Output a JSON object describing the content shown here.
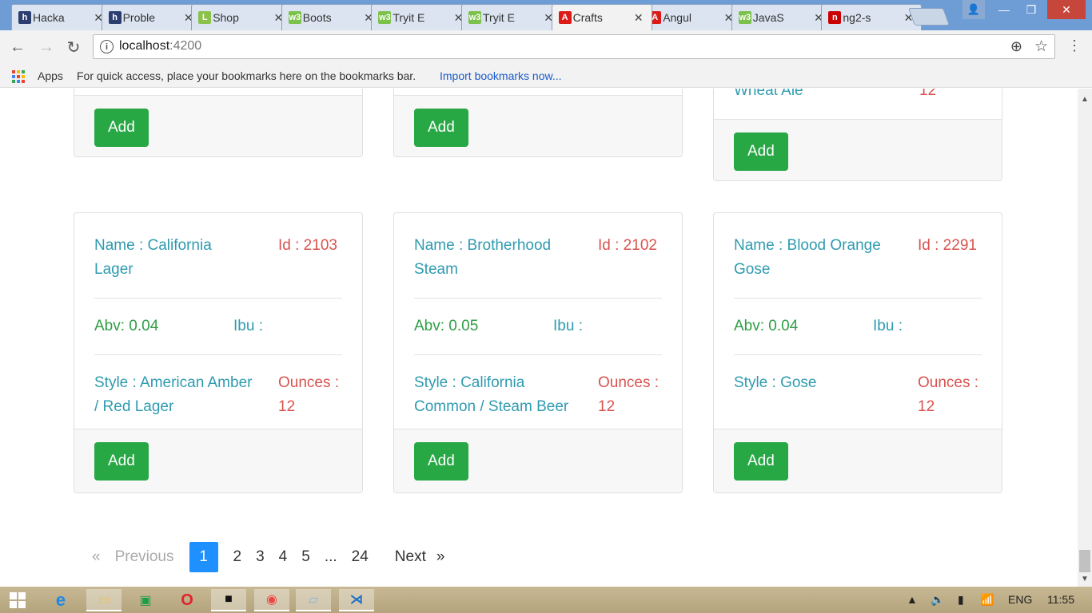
{
  "browser": {
    "tabs": [
      {
        "title": "Hacka",
        "icon": "hackerrank-icon",
        "color": "#2c3e70",
        "glyph": "h"
      },
      {
        "title": "Proble",
        "icon": "hackerrank-icon",
        "color": "#2c3e70",
        "glyph": "h"
      },
      {
        "title": "Shop",
        "icon": "leaf-icon",
        "color": "#8bc34a",
        "glyph": "L"
      },
      {
        "title": "Boots",
        "icon": "w3schools-icon",
        "color": "#7cc24a",
        "glyph": "w3"
      },
      {
        "title": "Tryit E",
        "icon": "w3schools-icon",
        "color": "#7cc24a",
        "glyph": "w3"
      },
      {
        "title": "Tryit E",
        "icon": "w3schools-icon",
        "color": "#7cc24a",
        "glyph": "w3"
      },
      {
        "title": "Crafts",
        "icon": "angular-icon",
        "color": "#dd1b16",
        "glyph": "A",
        "active": true
      },
      {
        "title": "Angul",
        "icon": "angular-icon",
        "color": "#dd1b16",
        "glyph": "A"
      },
      {
        "title": "JavaS",
        "icon": "w3schools-icon",
        "color": "#7cc24a",
        "glyph": "w3"
      },
      {
        "title": "ng2-s",
        "icon": "npm-icon",
        "color": "#cb0000",
        "glyph": "n"
      }
    ],
    "url_host": "localhost",
    "url_port": ":4200",
    "bookmarks_apps": "Apps",
    "bookmarks_hint": "For quick access, place your bookmarks here on the bookmarks bar.",
    "bookmarks_import": "Import bookmarks now..."
  },
  "page": {
    "top_cards": [
      {
        "add_label": "Add",
        "partial_left": "",
        "partial_right": ""
      },
      {
        "add_label": "Add",
        "partial_left": "",
        "partial_right": ""
      },
      {
        "add_label": "Add",
        "partial_left": "Wheat Ale",
        "partial_right": "12"
      }
    ],
    "beers": [
      {
        "name": "Name : California Lager",
        "id": "Id : 2103",
        "abv": "Abv: 0.04",
        "ibu": "Ibu :",
        "style": "Style : American Amber / Red Lager",
        "ounces": "Ounces : 12",
        "add_label": "Add"
      },
      {
        "name": "Name : Brotherhood Steam",
        "id": "Id : 2102",
        "abv": "Abv: 0.05",
        "ibu": "Ibu :",
        "style": "Style : California Common / Steam Beer",
        "ounces": "Ounces : 12",
        "add_label": "Add"
      },
      {
        "name": "Name : Blood Orange Gose",
        "id": "Id : 2291",
        "abv": "Abv: 0.04",
        "ibu": "Ibu :",
        "style": "Style : Gose",
        "ounces": "Ounces : 12",
        "add_label": "Add"
      }
    ],
    "pagination": {
      "first": "«",
      "previous": "Previous",
      "pages": [
        "1",
        "2",
        "3",
        "4",
        "5",
        "...",
        "24"
      ],
      "current": "1",
      "next": "Next",
      "last": "»"
    }
  },
  "taskbar": {
    "language": "ENG",
    "time": "11:55"
  }
}
